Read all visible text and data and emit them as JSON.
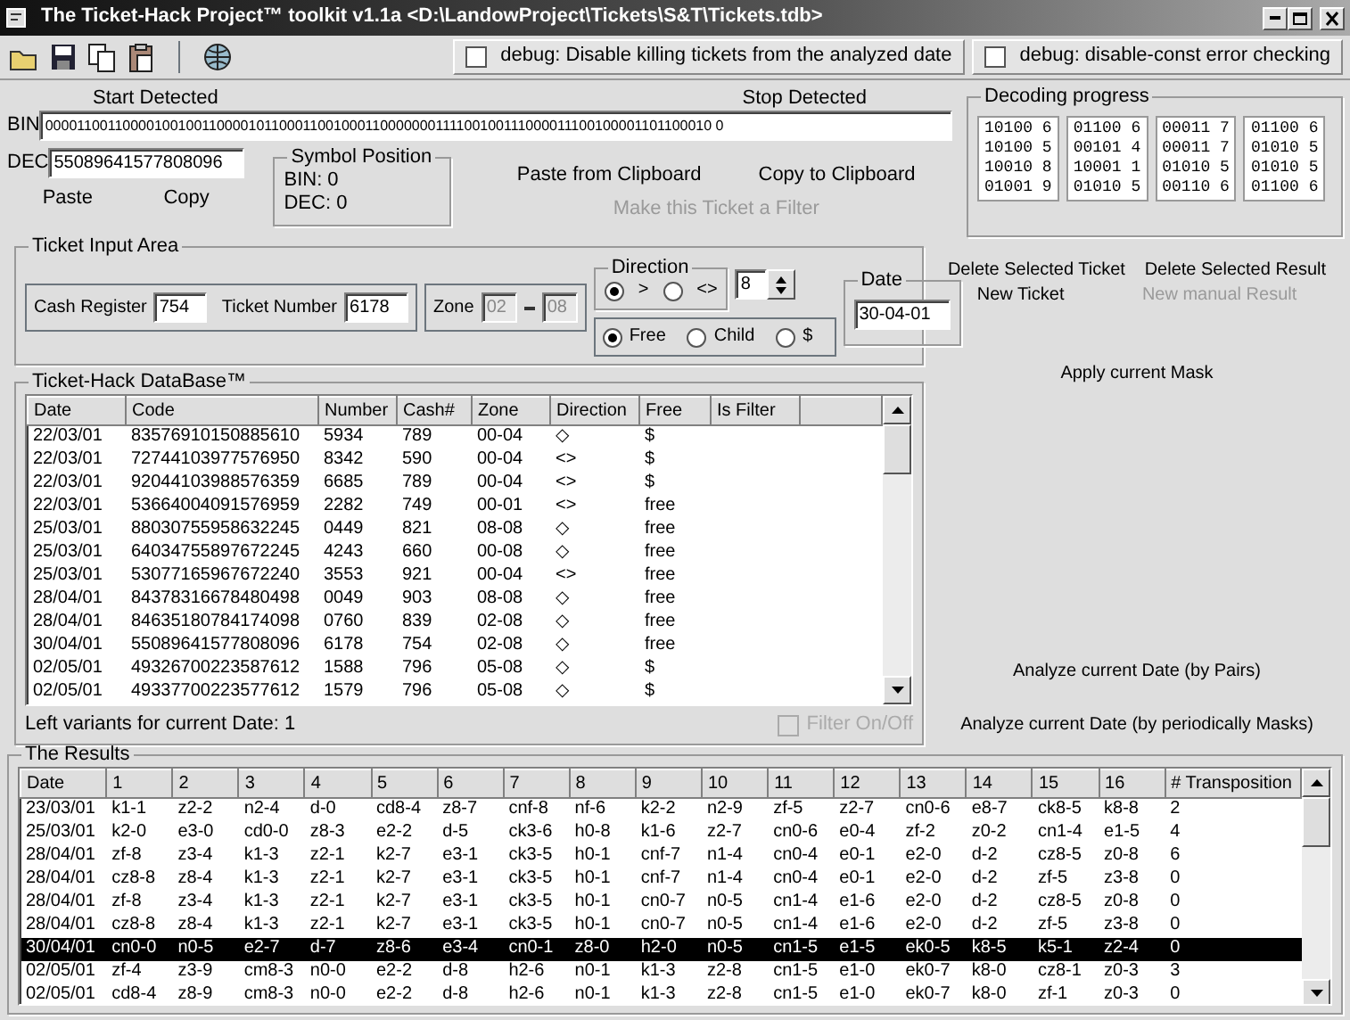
{
  "window": {
    "title": "The Ticket-Hack Project™ toolkit v1.1a  <D:\\LandowProject\\Tickets\\S&T\\Tickets.tdb>"
  },
  "toolbar": {
    "tools": [
      {
        "kind": "open"
      },
      {
        "kind": "save"
      },
      {
        "kind": "copy"
      },
      {
        "kind": "paste"
      },
      {
        "kind": "globe"
      }
    ],
    "checkboxes": [
      {
        "label": "debug: Disable killing tickets from the analyzed date",
        "checked": false
      },
      {
        "label": "debug: disable-const error checking",
        "checked": false
      }
    ]
  },
  "detection": {
    "start_label": "Start Detected",
    "stop_label": "Stop Detected",
    "bin_label": "BIN",
    "bin_value": "00001100110000100100110000101100011001000110000000111100100111000011100100001101100010 0",
    "dec_label": "DEC",
    "dec_value": "55089641577808096",
    "symbol_position": {
      "title": "Symbol Position",
      "bin": "BIN: 0",
      "dec": "DEC: 0"
    },
    "dec_buttons": [
      {
        "label": "Paste",
        "disabled": false
      },
      {
        "label": "Copy",
        "disabled": false
      }
    ],
    "clipboard_buttons": [
      {
        "label": "Paste from Clipboard",
        "disabled": false
      },
      {
        "label": "Copy to Clipboard",
        "disabled": false
      }
    ],
    "filter_button": {
      "label": "Make this Ticket a Filter",
      "disabled": true
    }
  },
  "decoding_progress": {
    "title": "Decoding progress",
    "columns": [
      [
        "10100 6",
        "10100 5",
        "10010 8",
        "01001 9"
      ],
      [
        "01100 6",
        "00101 4",
        "10001 1",
        "01010 5"
      ],
      [
        "00011 7",
        "00011 7",
        "01010 5",
        "00110 6"
      ],
      [
        "01100 6",
        "01010 5",
        "01010 5",
        "01100 6"
      ]
    ]
  },
  "ticket_input": {
    "title": "Ticket Input Area",
    "cash_register_label": "Cash Register",
    "cash_register": "754",
    "ticket_number_label": "Ticket Number",
    "ticket_number": "6178",
    "zone_label": "Zone",
    "zone_from": "02",
    "zone_to": "08",
    "zone_disabled": true,
    "direction": {
      "title": "Direction",
      "options": [
        {
          "label": ">",
          "selected": true
        },
        {
          "label": "<>",
          "selected": false
        }
      ],
      "count": "8"
    },
    "fare": [
      {
        "label": "Free",
        "selected": true
      },
      {
        "label": "Child",
        "selected": false
      },
      {
        "label": "$",
        "selected": false
      }
    ],
    "date": {
      "title": "Date",
      "value": "30-04-01"
    }
  },
  "database": {
    "title": "Ticket-Hack DataBase™",
    "columns": [
      "Date",
      "Code",
      "Number",
      "Cash#",
      "Zone",
      "Direction",
      "Free",
      "Is Filter"
    ],
    "rows": [
      [
        "22/03/01",
        "83576910150885610",
        "5934",
        "789",
        "00-04",
        "◇",
        "$"
      ],
      [
        "22/03/01",
        "72744103977576950",
        "8342",
        "590",
        "00-04",
        "<>",
        "$"
      ],
      [
        "22/03/01",
        "92044103988576359",
        "6685",
        "789",
        "00-04",
        "<>",
        "$"
      ],
      [
        "22/03/01",
        "53664004091576959",
        "2282",
        "749",
        "00-01",
        "<>",
        "free"
      ],
      [
        "25/03/01",
        "88030755958632245",
        "0449",
        "821",
        "08-08",
        "◇",
        "free"
      ],
      [
        "25/03/01",
        "64034755897672245",
        "4243",
        "660",
        "00-08",
        "◇",
        "free"
      ],
      [
        "25/03/01",
        "53077165967672240",
        "3553",
        "921",
        "00-04",
        "<>",
        "free"
      ],
      [
        "28/04/01",
        "84378316678480498",
        "0049",
        "903",
        "08-08",
        "◇",
        "free"
      ],
      [
        "28/04/01",
        "84635180784174098",
        "0760",
        "839",
        "02-08",
        "◇",
        "free"
      ],
      [
        "30/04/01",
        "55089641577808096",
        "6178",
        "754",
        "02-08",
        "◇",
        "free"
      ],
      [
        "02/05/01",
        "49326700223587612",
        "1588",
        "796",
        "05-08",
        "◇",
        "$"
      ],
      [
        "02/05/01",
        "49337700223577612",
        "1579",
        "796",
        "05-08",
        "◇",
        "$"
      ]
    ],
    "status": "Left variants for current Date: 1",
    "filter": {
      "label": "Filter On/Off",
      "checked": false,
      "disabled": true
    }
  },
  "actions": [
    [
      {
        "label": "Delete Selected Ticket",
        "disabled": false
      },
      {
        "label": "Delete Selected Result",
        "disabled": false
      }
    ],
    [
      {
        "label": "New Ticket",
        "disabled": false
      },
      {
        "label": "New manual Result",
        "disabled": true
      }
    ],
    [
      {
        "label": "Apply current Mask",
        "disabled": false
      }
    ],
    [
      {
        "label": "Analyze current Date (by Pairs)",
        "disabled": false
      }
    ],
    [
      {
        "label": "Analyze current Date (by periodically Masks)",
        "disabled": false
      }
    ]
  ],
  "results": {
    "title": "The Results",
    "columns": [
      "Date",
      "1",
      "2",
      "3",
      "4",
      "5",
      "6",
      "7",
      "8",
      "9",
      "10",
      "11",
      "12",
      "13",
      "14",
      "15",
      "16",
      "# Transposition"
    ],
    "rows": [
      {
        "selected": false,
        "cells": [
          "23/03/01",
          "k1-1",
          "z2-2",
          "n2-4",
          "d-0",
          "cd8-4",
          "z8-7",
          "cnf-8",
          "nf-6",
          "k2-2",
          "n2-9",
          "zf-5",
          "z2-7",
          "cn0-6",
          "e8-7",
          "ck8-5",
          "k8-8",
          "2"
        ]
      },
      {
        "selected": false,
        "cells": [
          "25/03/01",
          "k2-0",
          "e3-0",
          "cd0-0",
          "z8-3",
          "e2-2",
          "d-5",
          "ck3-6",
          "h0-8",
          "k1-6",
          "z2-7",
          "cn0-6",
          "e0-4",
          "zf-2",
          "z0-2",
          "cn1-4",
          "e1-5",
          "4"
        ]
      },
      {
        "selected": false,
        "cells": [
          "28/04/01",
          "zf-8",
          "z3-4",
          "k1-3",
          "z2-1",
          "k2-7",
          "e3-1",
          "ck3-5",
          "h0-1",
          "cnf-7",
          "n1-4",
          "cn0-4",
          "e0-1",
          "e2-0",
          "d-2",
          "cz8-5",
          "z0-8",
          "6"
        ]
      },
      {
        "selected": false,
        "cells": [
          "28/04/01",
          "cz8-8",
          "z8-4",
          "k1-3",
          "z2-1",
          "k2-7",
          "e3-1",
          "ck3-5",
          "h0-1",
          "cnf-7",
          "n1-4",
          "cn0-4",
          "e0-1",
          "e2-0",
          "d-2",
          "zf-5",
          "z3-8",
          "0"
        ]
      },
      {
        "selected": false,
        "cells": [
          "28/04/01",
          "zf-8",
          "z3-4",
          "k1-3",
          "z2-1",
          "k2-7",
          "e3-1",
          "ck3-5",
          "h0-1",
          "cn0-7",
          "n0-5",
          "cn1-4",
          "e1-6",
          "e2-0",
          "d-2",
          "cz8-5",
          "z0-8",
          "0"
        ]
      },
      {
        "selected": false,
        "cells": [
          "28/04/01",
          "cz8-8",
          "z8-4",
          "k1-3",
          "z2-1",
          "k2-7",
          "e3-1",
          "ck3-5",
          "h0-1",
          "cn0-7",
          "n0-5",
          "cn1-4",
          "e1-6",
          "e2-0",
          "d-2",
          "zf-5",
          "z3-8",
          "0"
        ]
      },
      {
        "selected": true,
        "cells": [
          "30/04/01",
          "cn0-0",
          "n0-5",
          "e2-7",
          "d-7",
          "z8-6",
          "e3-4",
          "cn0-1",
          "z8-0",
          "h2-0",
          "n0-5",
          "cn1-5",
          "e1-5",
          "ek0-5",
          "k8-5",
          "k5-1",
          "z2-4",
          "0"
        ]
      },
      {
        "selected": false,
        "cells": [
          "02/05/01",
          "zf-4",
          "z3-9",
          "cm8-3",
          "n0-0",
          "e2-2",
          "d-8",
          "h2-6",
          "n0-1",
          "k1-3",
          "z2-8",
          "cn1-5",
          "e1-0",
          "ek0-7",
          "k8-0",
          "cz8-1",
          "z0-3",
          "3"
        ]
      },
      {
        "selected": false,
        "cells": [
          "02/05/01",
          "cd8-4",
          "z8-9",
          "cm8-3",
          "n0-0",
          "e2-2",
          "d-8",
          "h2-6",
          "n0-1",
          "k1-3",
          "z2-8",
          "cn1-5",
          "e1-0",
          "ek0-7",
          "k8-0",
          "zf-1",
          "z0-3",
          "0"
        ]
      }
    ]
  }
}
